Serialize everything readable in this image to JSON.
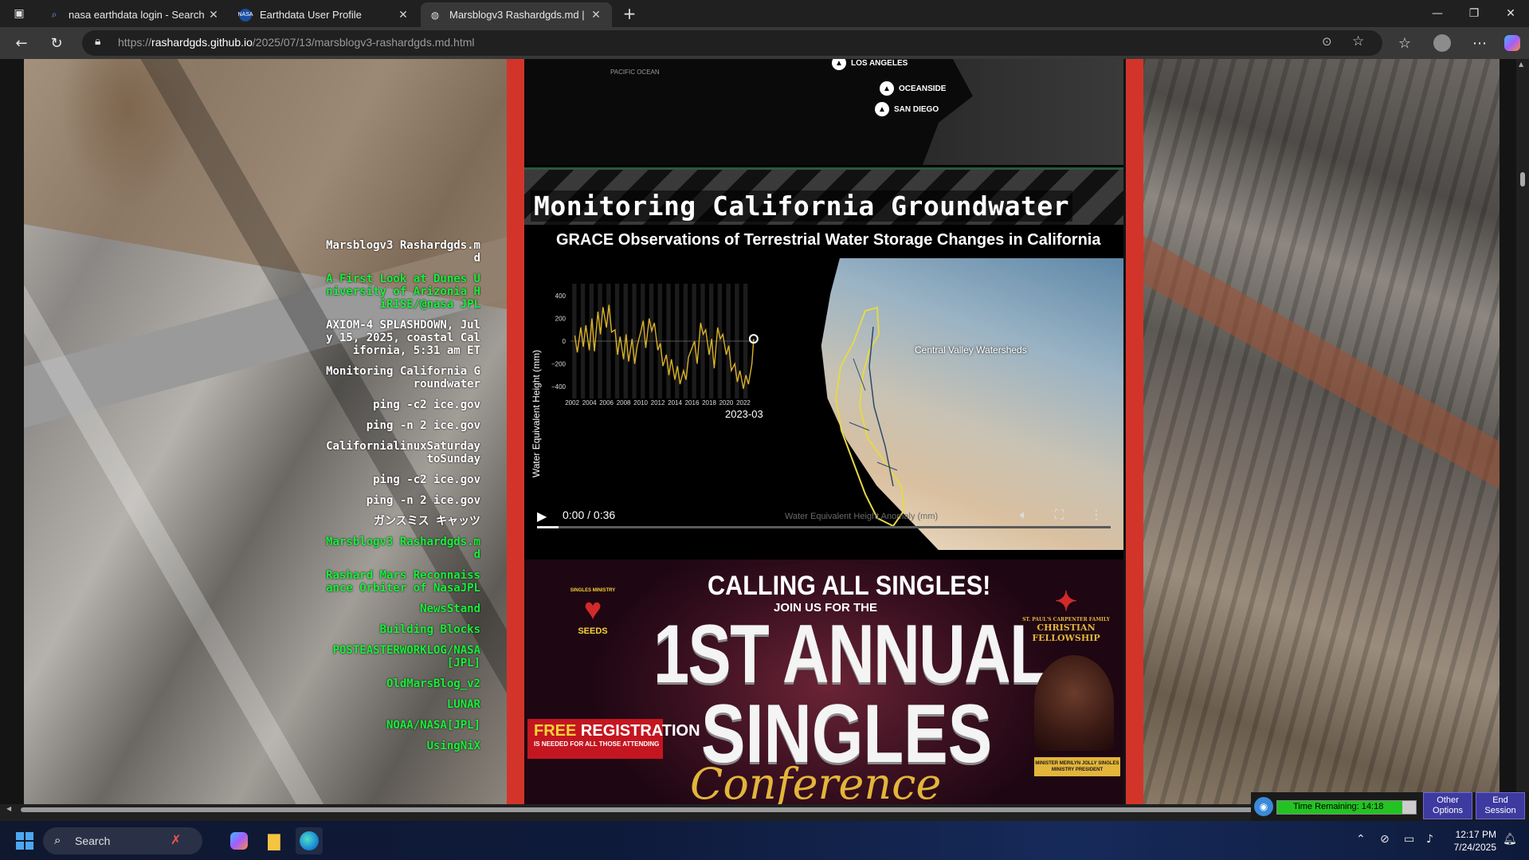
{
  "browser": {
    "tabs": [
      {
        "title": "nasa earthdata login - Search",
        "icon": "search-icon"
      },
      {
        "title": "Earthdata User Profile",
        "icon": "nasa-icon"
      },
      {
        "title": "Marsblogv3 Rashardgds.md | (",
        "icon": "globe-icon"
      }
    ],
    "new_tab": "+",
    "url_scheme": "https://",
    "url_host": "rashardgds.github.io",
    "url_path": "/2025/07/13/marsblogv3-rashardgds.md.html"
  },
  "sidenav": [
    {
      "label": "Marsblogv3 Rashardgds.md",
      "color": "white"
    },
    {
      "label": "A First Look at Dunes University of Arizonia HiRISE/@nasa JPL",
      "color": "green"
    },
    {
      "label": "AXIOM-4 SPLASHDOWN, July 15, 2025, coastal California, 5:31 am ET",
      "color": "white"
    },
    {
      "label": "Monitoring California Groundwater",
      "color": "white"
    },
    {
      "label": "ping -c2 ice.gov",
      "color": "white"
    },
    {
      "label": "ping -n 2 ice.gov",
      "color": "white"
    },
    {
      "label": "CalifornialinuxSaturdaytoSunday",
      "color": "white"
    },
    {
      "label": "ping -c2 ice.gov",
      "color": "white"
    },
    {
      "label": "ping -n 2 ice.gov",
      "color": "white"
    },
    {
      "label": "ガンスミス キャッツ",
      "color": "white"
    },
    {
      "label": "Marsblogv3 Rashardgds.md",
      "color": "green"
    },
    {
      "label": "Rashard Mars Reconnaissance Orbiter of NasaJPL",
      "color": "green"
    },
    {
      "label": "NewsStand",
      "color": "green"
    },
    {
      "label": "Building Blocks",
      "color": "green"
    },
    {
      "label": "POSTEASTERWORKLOG/NASA[JPL]",
      "color": "green"
    },
    {
      "label": "OldMarsBlog_v2",
      "color": "green"
    },
    {
      "label": "LUNAR",
      "color": "green"
    },
    {
      "label": "NOAA/NASA[JPL]",
      "color": "green"
    },
    {
      "label": "UsingNiX",
      "color": "green"
    }
  ],
  "map": {
    "ocean_label": "PACIFIC OCEAN",
    "cities": [
      "LOS ANGELES",
      "OCEANSIDE",
      "SAN DIEGO"
    ]
  },
  "section_title": "Monitoring California Groundwater",
  "video": {
    "title": "GRACE Observations of Terrestrial Water Storage Changes in California",
    "map_label": "Central Valley Watersheds",
    "caption": "Water Equivalent Height Anomaly (mm)",
    "time": "0:00 / 0:36",
    "progress": 0.037
  },
  "chart_data": {
    "type": "line",
    "title": "",
    "ylabel": "Water Equivalent Height (mm)",
    "xlabel": "",
    "ylim": [
      -450,
      450
    ],
    "yticks": [
      400,
      200,
      0,
      -200,
      -400
    ],
    "xticks": [
      "2002",
      "2004",
      "2006",
      "2008",
      "2010",
      "2012",
      "2014",
      "2016",
      "2018",
      "2020",
      "2022"
    ],
    "current_label": "2023-03",
    "series": [
      {
        "color": "#d9b12a",
        "x": [
          2002.3,
          2002.6,
          2003.0,
          2003.3,
          2003.6,
          2004.0,
          2004.3,
          2004.6,
          2005.0,
          2005.3,
          2005.6,
          2006.0,
          2006.3,
          2006.6,
          2007.0,
          2007.3,
          2007.6,
          2008.0,
          2008.3,
          2008.6,
          2009.0,
          2009.3,
          2009.6,
          2010.0,
          2010.3,
          2010.6,
          2011.0,
          2011.3,
          2011.6,
          2012.0,
          2012.3,
          2012.6,
          2013.0,
          2013.3,
          2013.6,
          2014.0,
          2014.3,
          2014.6,
          2015.0,
          2015.3,
          2015.6,
          2016.0,
          2016.3,
          2016.6,
          2017.0,
          2017.3,
          2017.6,
          2018.0,
          2018.3,
          2018.6,
          2019.0,
          2019.3,
          2019.6,
          2020.0,
          2020.3,
          2020.6,
          2021.0,
          2021.3,
          2021.6,
          2022.0,
          2022.3,
          2022.6,
          2023.0,
          2023.2
        ],
        "values": [
          50,
          -100,
          120,
          -50,
          140,
          -80,
          200,
          -90,
          260,
          60,
          300,
          120,
          320,
          80,
          100,
          -120,
          40,
          -160,
          60,
          -180,
          20,
          -200,
          -40,
          80,
          180,
          -60,
          200,
          90,
          160,
          -80,
          -20,
          -220,
          -120,
          -300,
          -160,
          -340,
          -220,
          -380,
          -260,
          -340,
          -140,
          -60,
          0,
          -200,
          160,
          60,
          100,
          -120,
          20,
          -240,
          120,
          20,
          60,
          -120,
          -40,
          -260,
          -200,
          -360,
          -260,
          -420,
          -300,
          -380,
          -200,
          20
        ]
      }
    ]
  },
  "poster": {
    "headline": "CALLING ALL SINGLES!",
    "join": "JOIN US FOR THE",
    "annual": "1ST ANNUAL",
    "singles": "SINGLES",
    "conference": "Conference",
    "free_reg_1": "FREE",
    "free_reg_2": "REGISTRATION",
    "free_reg_sub": "IS NEEDED FOR ALL THOSE ATTENDING",
    "ministry": "SEEDS",
    "ministry_top": "SINGLES MINISTRY",
    "fellowship": "CHRISTIAN FELLOWSHIP",
    "fellowship_top": "ST. PAUL'S CARPENTER FAMILY",
    "minister": "MINISTER MERILYN JOLLY SINGLES MINISTRY PRESIDENT"
  },
  "session": {
    "time_remaining": "Time Remaining: 14:18",
    "remaining_fraction": 0.9,
    "other_options": "Other Options",
    "end_session": "End Session"
  },
  "taskbar": {
    "search": "Search",
    "time": "12:17 PM",
    "date": "7/24/2025"
  }
}
